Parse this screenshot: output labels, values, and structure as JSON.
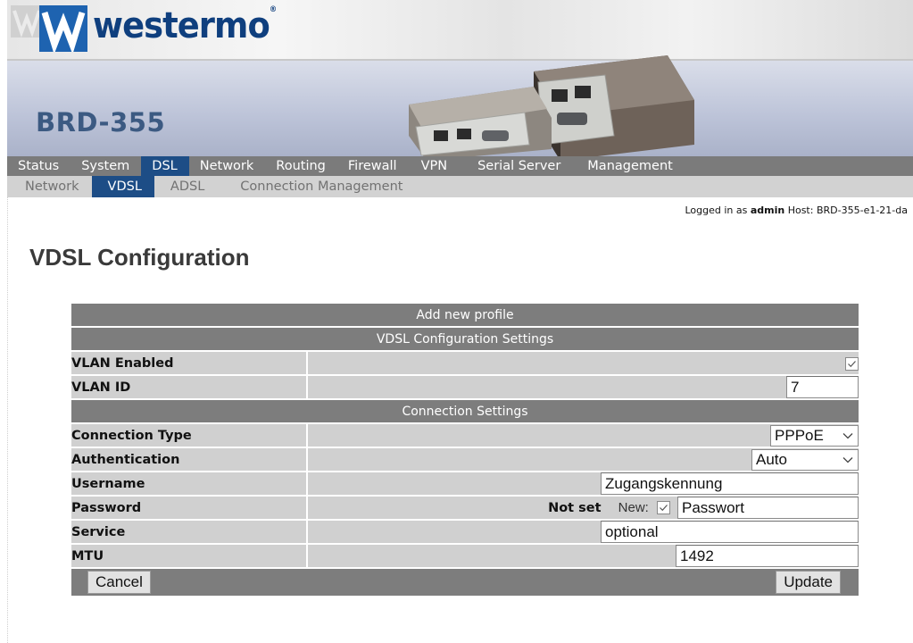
{
  "brand": {
    "logo_text": "westermo",
    "logo_mark": "W"
  },
  "product_title": "BRD-355",
  "main_menu": [
    {
      "label": "Status",
      "active": false
    },
    {
      "label": "System",
      "active": false
    },
    {
      "label": "DSL",
      "active": true
    },
    {
      "label": "Network",
      "active": false
    },
    {
      "label": "Routing",
      "active": false
    },
    {
      "label": "Firewall",
      "active": false
    },
    {
      "label": "VPN",
      "active": false
    },
    {
      "label": "Serial Server",
      "active": false
    },
    {
      "label": "Management",
      "active": false
    }
  ],
  "sub_menu": [
    {
      "label": "Network",
      "active": false
    },
    {
      "label": "VDSL",
      "active": true
    },
    {
      "label": "ADSL",
      "active": false
    },
    {
      "label": "Connection Management",
      "active": false
    }
  ],
  "login": {
    "prefix": "Logged in as",
    "user": "admin",
    "host_label": "Host:",
    "host": "BRD-355-e1-21-da"
  },
  "page_title": "VDSL Configuration",
  "form": {
    "add_profile": "Add new profile",
    "vdsl_header": "VDSL Configuration Settings",
    "vlan_enabled_label": "VLAN Enabled",
    "vlan_enabled_checked": true,
    "vlan_id_label": "VLAN ID",
    "vlan_id_value": "7",
    "connection_header": "Connection Settings",
    "connection_type_label": "Connection Type",
    "connection_type_value": "PPPoE",
    "authentication_label": "Authentication",
    "authentication_value": "Auto",
    "username_label": "Username",
    "username_value": "Zugangskennung",
    "password_label": "Password",
    "password_status": "Not set",
    "password_new_label": "New:",
    "password_new_checked": true,
    "password_value": "Passwort",
    "service_label": "Service",
    "service_value": "optional",
    "mtu_label": "MTU",
    "mtu_value": "1492",
    "cancel_label": "Cancel",
    "update_label": "Update"
  },
  "colors": {
    "menu_bg": "#7b7b7b",
    "submenu_bg": "#d2d2d2",
    "active_tab": "#1d4d86",
    "table_header": "#7d7d7d",
    "row_bg": "#d0d0d0",
    "title_blue": "#3c5a82",
    "logo_blue": "#1e63b0"
  }
}
